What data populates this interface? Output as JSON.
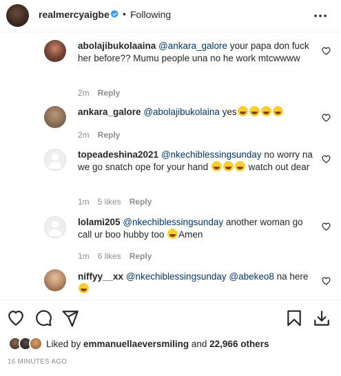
{
  "header": {
    "username": "realmercyaigbe",
    "separator": "•",
    "follow_status": "Following",
    "more_icon": "more-horizontal-icon"
  },
  "comments": [
    {
      "username": "abolajibukolaaina",
      "mention": "@ankara_galore",
      "text": " your papa don fuck her before?? Mumu people una no he work mtcwwww",
      "time": "2m",
      "likes": "",
      "reply": "Reply"
    },
    {
      "username": "ankara_galore",
      "mention": "@abolajibukolaina",
      "text": " yes",
      "time": "2m",
      "likes": "",
      "reply": "Reply"
    },
    {
      "username": "topeadeshina2021",
      "mention": "@nkechiblessingsunday",
      "text": " no worry na we go snatch ope for your hand",
      "text2": " watch out dear",
      "time": "1m",
      "likes": "5 likes",
      "reply": "Reply"
    },
    {
      "username": "lolami205",
      "mention": "@nkechiblessingsunday",
      "text": " another woman go call ur boo hubby too ",
      "text2": "Amen",
      "time": "1m",
      "likes": "6 likes",
      "reply": "Reply"
    },
    {
      "username": "niffyy__xx",
      "mention": "@nkechiblessingsunday",
      "mention2": "@abekeo8",
      "text": " na here",
      "time": "",
      "likes": "",
      "reply": ""
    }
  ],
  "likes": {
    "prefix": "Liked by ",
    "user": "emmanuellaeversmiling",
    "middle": " and ",
    "count": "22,966 others"
  },
  "timestamp": "16 MINUTES AGO",
  "icons": {
    "like": "heart-icon",
    "comment": "comment-icon",
    "share": "share-icon",
    "save": "bookmark-icon",
    "download": "download-icon"
  },
  "colors": {
    "verified": "#3897f0",
    "mention": "#00376b",
    "meta": "#8e8e8e"
  }
}
